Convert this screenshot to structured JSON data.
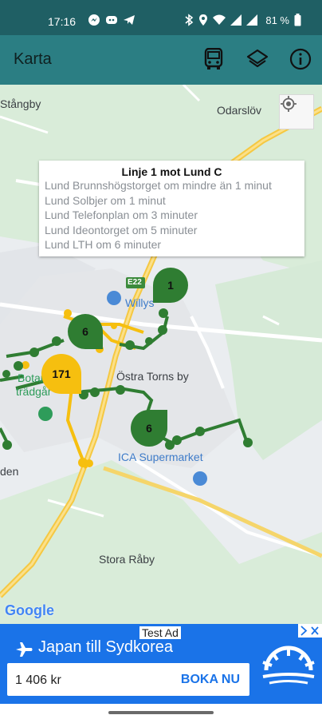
{
  "status": {
    "time": "17:16",
    "battery": "81 %",
    "left_icons": [
      "messenger-icon",
      "discord-icon",
      "telegram-icon"
    ],
    "right_icons": [
      "bluetooth-icon",
      "location-icon",
      "wifi-icon",
      "signal-icon",
      "signal-icon",
      "battery-icon"
    ]
  },
  "appbar": {
    "title": "Karta",
    "actions": [
      "bus-icon",
      "layers-icon",
      "info-icon"
    ]
  },
  "map": {
    "labels": {
      "stangby": "Stångby",
      "odarslov": "Odarslöv",
      "willys": "Willys",
      "ostra_torns_by": "Östra Torns by",
      "botaniska": "Botani",
      "tradgarden": "trädgår",
      "ica": "ICA Supermarket",
      "den": "den",
      "stora_raby": "Stora Råby",
      "e22": "E22"
    },
    "popup": {
      "title": "Linje 1 mot Lund C",
      "lines": [
        "Lund Brunnshögstorget om mindre än 1 minut",
        "Lund Solbjer om 1 minut",
        "Lund Telefonplan om 3 minuter",
        "Lund Ideontorget om 5 minuter",
        "Lund LTH om 6 minuter"
      ]
    },
    "clusters": [
      {
        "label": "1",
        "color": "#2f7d32"
      },
      {
        "label": "6",
        "color": "#2f7d32"
      },
      {
        "label": "171",
        "color": "#f6bf0f"
      },
      {
        "label": "6",
        "color": "#2f7d32"
      }
    ],
    "google": "Google"
  },
  "ad": {
    "tag": "Test Ad",
    "title": "Japan till Sydkorea",
    "price": "1 406 kr",
    "cta": "BOKA NU"
  },
  "colors": {
    "statusbar": "#1f5f64",
    "appbar": "#2b7e83",
    "route_green": "#2f7d32",
    "route_yellow": "#f6bf0f",
    "ad_blue": "#1a73e8"
  }
}
